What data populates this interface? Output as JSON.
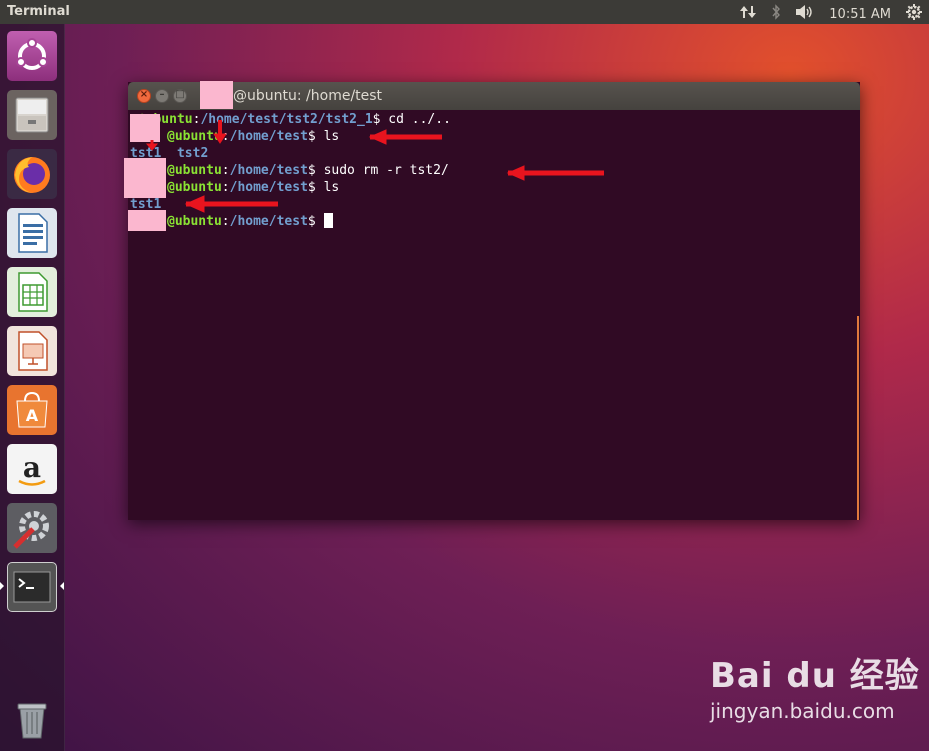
{
  "panel": {
    "app_title": "Terminal",
    "clock": "10:51 AM",
    "icons": [
      "network-updown-icon",
      "bluetooth-icon",
      "volume-icon",
      "settings-gear-icon"
    ]
  },
  "launcher": {
    "items": [
      {
        "name": "ubuntu-dash-icon",
        "label": "Search your computer"
      },
      {
        "name": "files-icon",
        "label": "Files"
      },
      {
        "name": "firefox-icon",
        "label": "Firefox Web Browser"
      },
      {
        "name": "libreoffice-writer-icon",
        "label": "LibreOffice Writer"
      },
      {
        "name": "libreoffice-calc-icon",
        "label": "LibreOffice Calc"
      },
      {
        "name": "libreoffice-impress-icon",
        "label": "LibreOffice Impress"
      },
      {
        "name": "ubuntu-software-icon",
        "label": "Ubuntu Software"
      },
      {
        "name": "amazon-icon",
        "label": "Amazon"
      },
      {
        "name": "system-settings-icon",
        "label": "System Settings"
      },
      {
        "name": "terminal-icon",
        "label": "Terminal"
      },
      {
        "name": "trash-icon",
        "label": "Trash"
      }
    ]
  },
  "window": {
    "title": "@ubuntu: /home/test"
  },
  "terminal": {
    "line1": {
      "user": "@ubuntu",
      "colon": ":",
      "path": "/home/test/tst2/tst2_1",
      "prompt": "$ ",
      "cmd": "cd ../.."
    },
    "line2": {
      "user": "@ubuntu",
      "colon": ":",
      "path": "/home/test",
      "prompt": "$ ",
      "cmd": "ls"
    },
    "line3": {
      "dir1": "tst1",
      "sep": "  ",
      "dir2": "tst2"
    },
    "line4": {
      "user": "@ubuntu",
      "colon": ":",
      "path": "/home/test",
      "prompt": "$ ",
      "cmd": "sudo rm -r tst2/"
    },
    "line5": {
      "user": "@ubuntu",
      "colon": ":",
      "path": "/home/test",
      "prompt": "$ ",
      "cmd": "ls"
    },
    "line6": {
      "dir1": "tst1"
    },
    "line7": {
      "user": "@ubuntu",
      "colon": ":",
      "path": "/home/test",
      "prompt": "$ "
    },
    "line1_prefix": "n"
  },
  "annotation_color": "#e8141e",
  "watermark": {
    "logo": "Bai du 经验",
    "url": "jingyan.baidu.com"
  }
}
